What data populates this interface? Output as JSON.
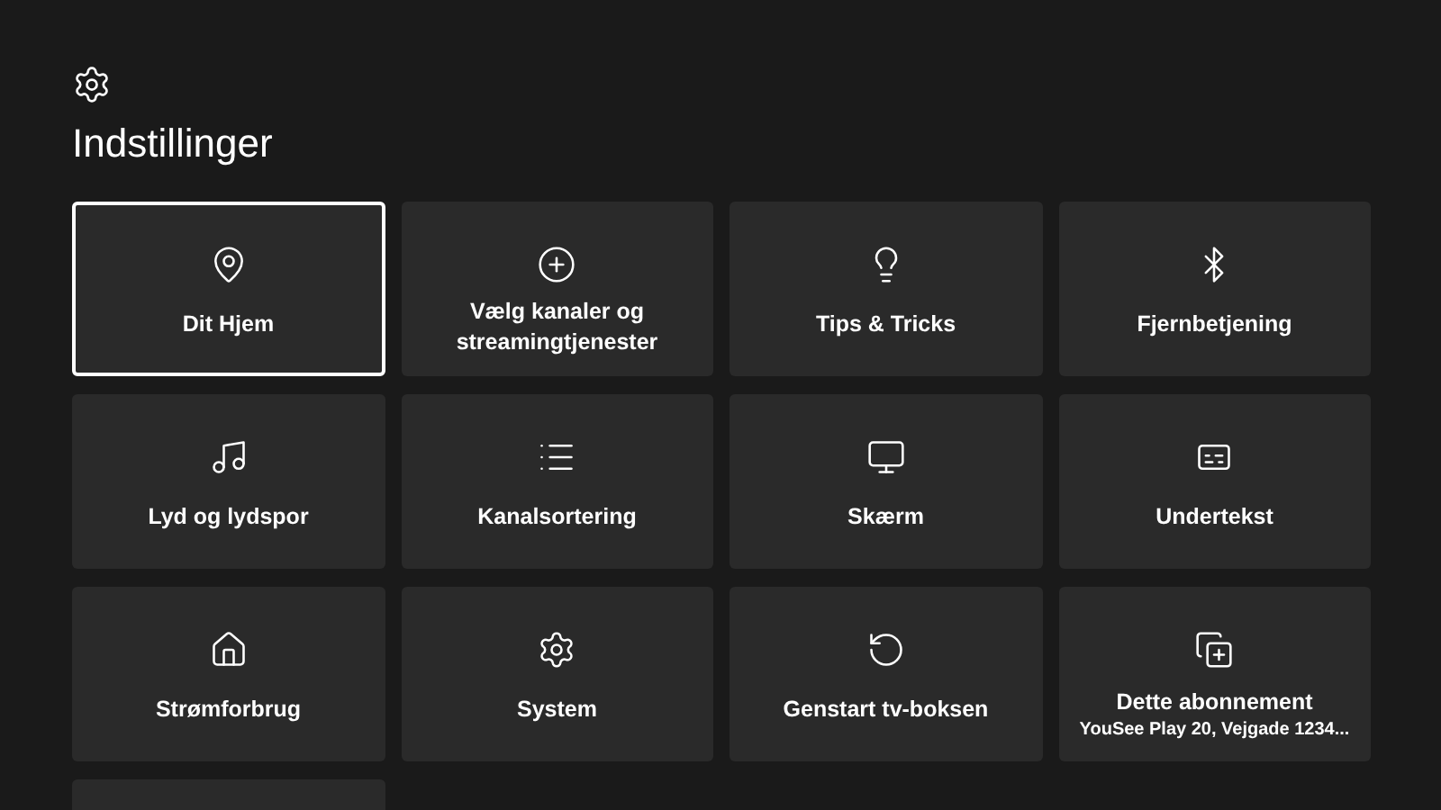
{
  "header": {
    "title": "Indstillinger"
  },
  "tiles": [
    {
      "label": "Dit Hjem",
      "selected": true
    },
    {
      "label": "Vælg kanaler og streamingtjenester",
      "selected": false
    },
    {
      "label": "Tips & Tricks",
      "selected": false
    },
    {
      "label": "Fjernbetjening",
      "selected": false
    },
    {
      "label": "Lyd og lydspor",
      "selected": false
    },
    {
      "label": "Kanalsortering",
      "selected": false
    },
    {
      "label": "Skærm",
      "selected": false
    },
    {
      "label": "Undertekst",
      "selected": false
    },
    {
      "label": "Strømforbrug",
      "selected": false
    },
    {
      "label": "System",
      "selected": false
    },
    {
      "label": "Genstart tv-boksen",
      "selected": false
    },
    {
      "label": "Dette abonnement",
      "subtitle": "YouSee Play 20, Vejgade 1234...",
      "selected": false
    },
    {
      "selected": false
    }
  ]
}
